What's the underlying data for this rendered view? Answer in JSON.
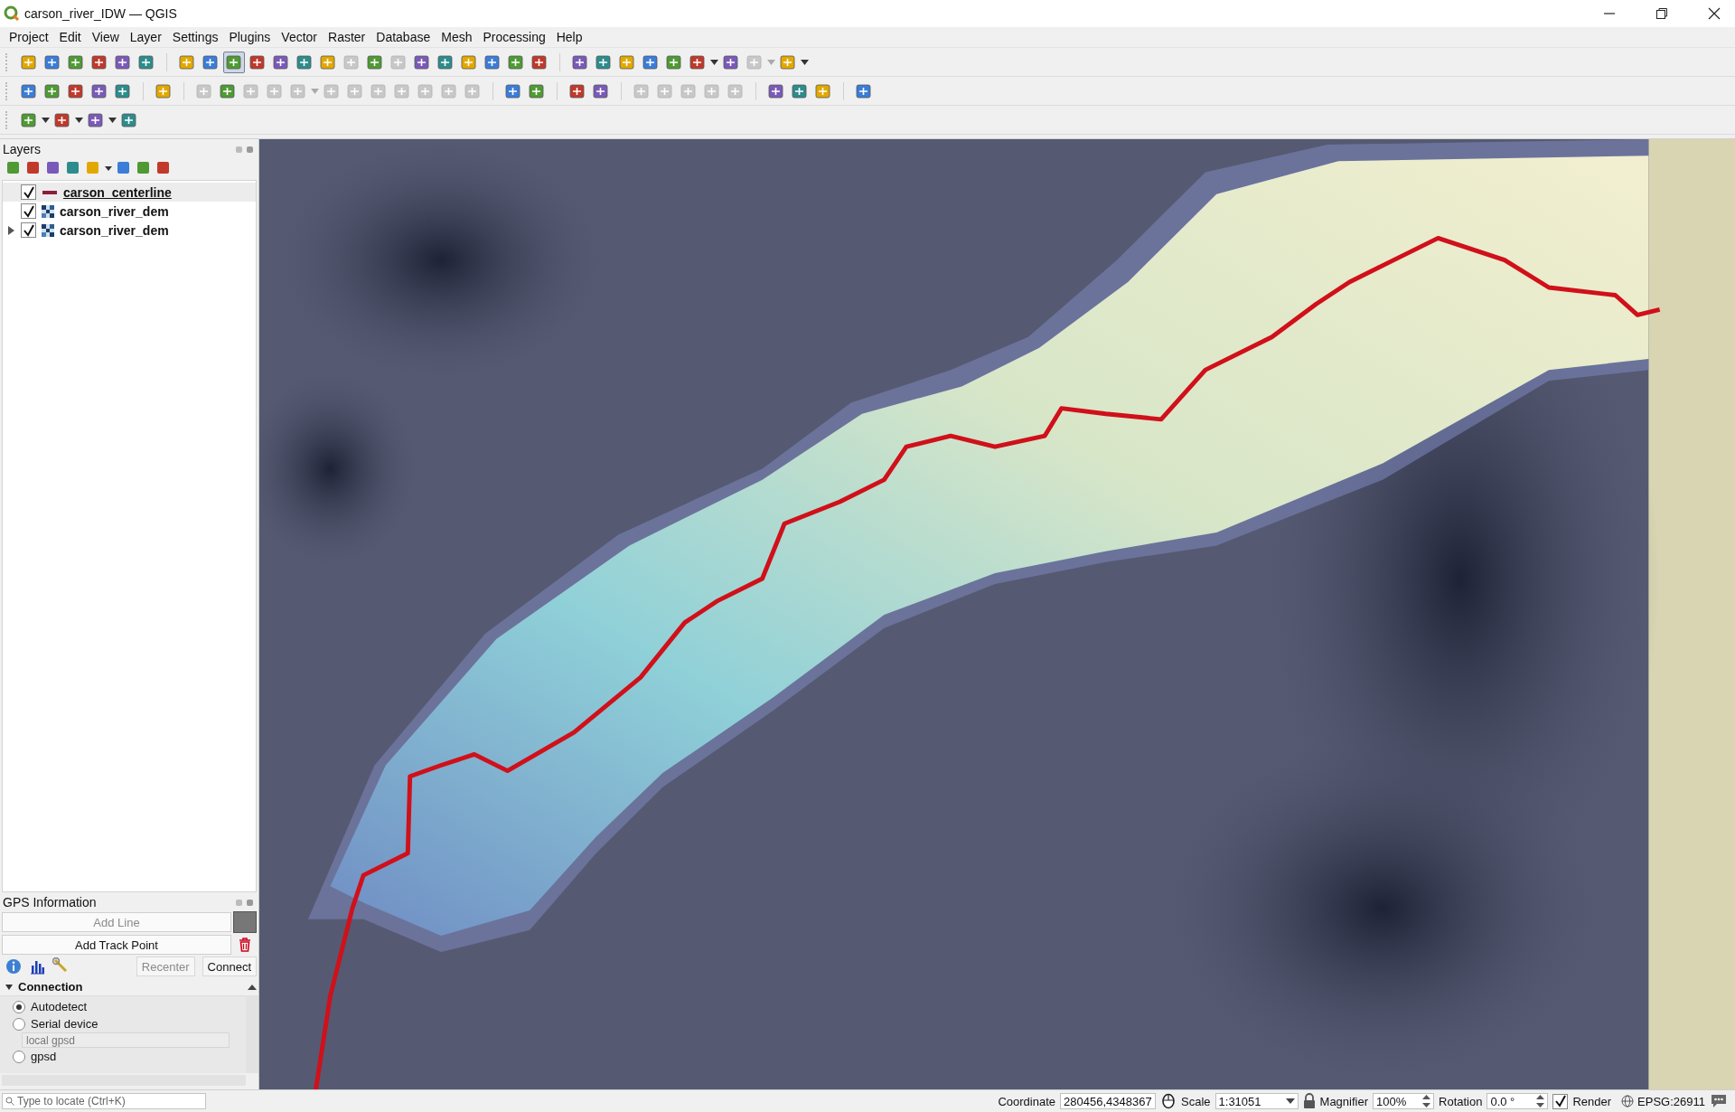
{
  "window": {
    "title": "carson_river_IDW — QGIS"
  },
  "menu": [
    "Project",
    "Edit",
    "View",
    "Layer",
    "Settings",
    "Plugins",
    "Vector",
    "Raster",
    "Database",
    "Mesh",
    "Processing",
    "Help"
  ],
  "toolbars": [
    [
      [
        {
          "selected": false,
          "disabled": false
        },
        {
          "selected": false,
          "disabled": false
        },
        {
          "selected": false,
          "disabled": false
        },
        {
          "selected": false,
          "disabled": false
        },
        {
          "selected": false,
          "disabled": false
        },
        {
          "selected": false,
          "disabled": false
        }
      ],
      [
        {
          "selected": false,
          "disabled": false
        },
        {
          "selected": false,
          "disabled": false
        },
        {
          "selected": true,
          "disabled": false
        },
        {
          "selected": false,
          "disabled": false
        },
        {
          "selected": false,
          "disabled": false
        },
        {
          "selected": false,
          "disabled": false
        },
        {
          "selected": false,
          "disabled": false
        },
        {
          "selected": false,
          "disabled": true
        },
        {
          "selected": false,
          "disabled": false
        },
        {
          "selected": false,
          "disabled": true
        },
        {
          "selected": false,
          "disabled": false
        },
        {
          "selected": false,
          "disabled": false
        },
        {
          "selected": false,
          "disabled": false
        },
        {
          "selected": false,
          "disabled": false
        },
        {
          "selected": false,
          "disabled": false
        },
        {
          "selected": false,
          "disabled": false
        }
      ],
      [
        {
          "selected": false,
          "disabled": false
        },
        {
          "selected": false,
          "disabled": false
        },
        {
          "selected": false,
          "disabled": false
        },
        {
          "selected": false,
          "disabled": false
        },
        {
          "selected": false,
          "disabled": false
        },
        {
          "selected": false,
          "disabled": false,
          "menu": true
        },
        {
          "selected": false,
          "disabled": false
        },
        {
          "selected": false,
          "disabled": true,
          "menu": true
        },
        {
          "selected": false,
          "disabled": false,
          "menu": true
        }
      ]
    ],
    [
      [
        {
          "selected": false,
          "disabled": false
        },
        {
          "selected": false,
          "disabled": false
        },
        {
          "selected": false,
          "disabled": false
        },
        {
          "selected": false,
          "disabled": false
        },
        {
          "selected": false,
          "disabled": false
        }
      ],
      [
        {
          "selected": false,
          "disabled": false
        }
      ],
      [
        {
          "selected": false,
          "disabled": true
        },
        {
          "selected": false,
          "disabled": false
        },
        {
          "selected": false,
          "disabled": true
        },
        {
          "selected": false,
          "disabled": true
        },
        {
          "selected": false,
          "disabled": true,
          "menu": true
        },
        {
          "selected": false,
          "disabled": true
        },
        {
          "selected": false,
          "disabled": true
        },
        {
          "selected": false,
          "disabled": true
        },
        {
          "selected": false,
          "disabled": true
        },
        {
          "selected": false,
          "disabled": true
        },
        {
          "selected": false,
          "disabled": true
        },
        {
          "selected": false,
          "disabled": true
        }
      ],
      [
        {
          "selected": false,
          "disabled": false
        },
        {
          "selected": false,
          "disabled": false
        }
      ],
      [
        {
          "selected": false,
          "disabled": false
        },
        {
          "selected": false,
          "disabled": false
        }
      ],
      [
        {
          "selected": false,
          "disabled": true
        },
        {
          "selected": false,
          "disabled": true
        },
        {
          "selected": false,
          "disabled": true
        },
        {
          "selected": false,
          "disabled": true
        },
        {
          "selected": false,
          "disabled": true
        }
      ],
      [
        {
          "selected": false,
          "disabled": false
        },
        {
          "selected": false,
          "disabled": false
        },
        {
          "selected": false,
          "disabled": false
        }
      ],
      [
        {
          "selected": false,
          "disabled": false
        }
      ]
    ],
    [
      [
        {
          "selected": false,
          "disabled": false,
          "menu": true
        },
        {
          "selected": false,
          "disabled": false,
          "menu": true
        },
        {
          "selected": false,
          "disabled": false,
          "menu": true
        },
        {
          "selected": false,
          "disabled": false
        }
      ]
    ]
  ],
  "layers_panel": {
    "title": "Layers",
    "tools": [
      {
        "menu": false
      },
      {
        "menu": false
      },
      {
        "menu": false
      },
      {
        "menu": false
      },
      {
        "menu": true
      },
      {
        "menu": false
      },
      {
        "menu": false
      },
      {
        "menu": false
      }
    ],
    "layers": [
      {
        "name": "carson_centerline",
        "kind": "line",
        "checked": true,
        "selected": true,
        "expandable": false
      },
      {
        "name": "carson_river_dem",
        "kind": "raster",
        "checked": true,
        "selected": false,
        "expandable": false
      },
      {
        "name": "carson_river_dem",
        "kind": "raster",
        "checked": true,
        "selected": false,
        "expandable": true
      }
    ]
  },
  "gps_panel": {
    "title": "GPS Information",
    "add_line": {
      "label": "Add Line",
      "disabled": true
    },
    "add_track_point": {
      "label": "Add Track Point",
      "disabled": false
    },
    "recenter": {
      "label": "Recenter",
      "disabled": true
    },
    "connect": {
      "label": "Connect",
      "disabled": false
    },
    "section": {
      "label": "Connection",
      "expanded": true
    },
    "options": [
      {
        "kind": "radio",
        "label": "Autodetect",
        "selected": true
      },
      {
        "kind": "radio",
        "label": "Serial device",
        "selected": false
      },
      {
        "kind": "field",
        "placeholder": "local gpsd"
      },
      {
        "kind": "radio",
        "label": "gpsd",
        "selected": false
      }
    ]
  },
  "status_bar": {
    "locator": {
      "placeholder": "Type to locate (Ctrl+K)"
    },
    "coordinate_label": "Coordinate",
    "coordinate": "280456,4348367",
    "scale_label": "Scale",
    "scale": "1:31051",
    "magnifier_label": "Magnifier",
    "magnifier": "100%",
    "rotation_label": "Rotation",
    "rotation": "0.0 °",
    "render": {
      "label": "Render",
      "checked": true
    },
    "crs": "EPSG:26911"
  }
}
